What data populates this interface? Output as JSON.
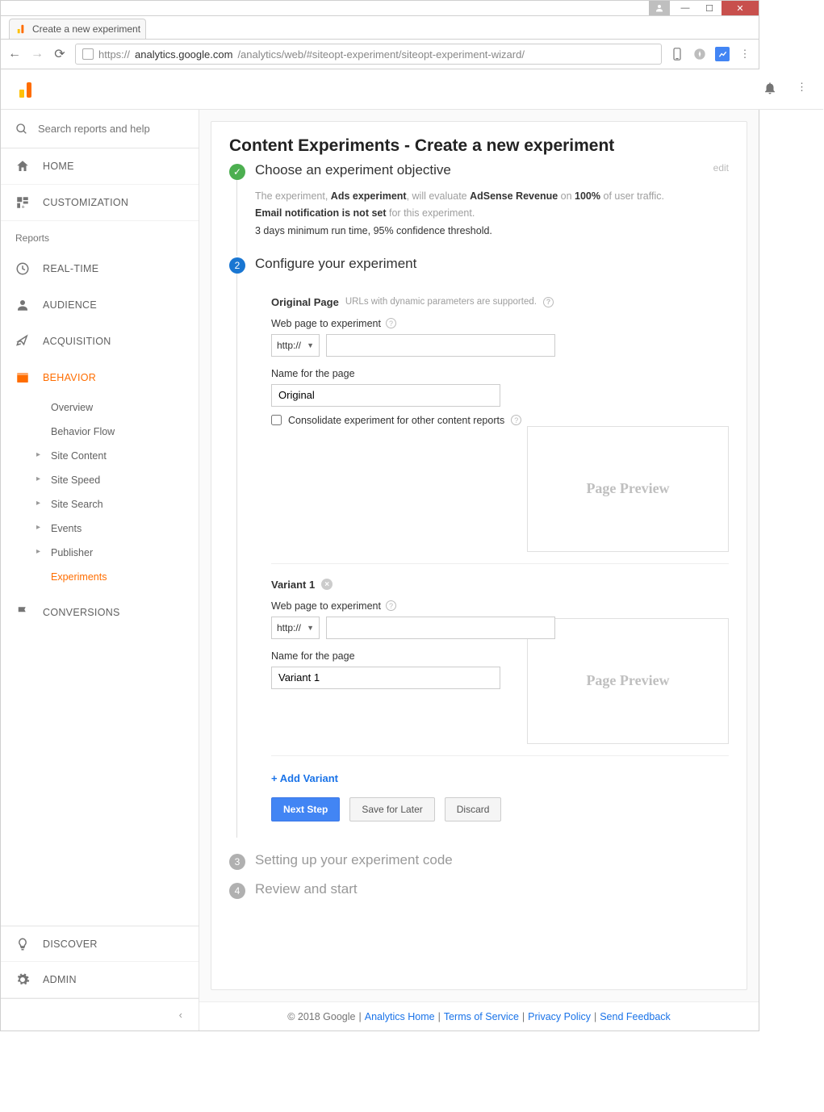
{
  "browser": {
    "tab_title": "Create a new experiment",
    "url_gray_prefix": "https://",
    "url_host": "analytics.google.com",
    "url_path": "/analytics/web/#siteopt-experiment/siteopt-experiment-wizard/"
  },
  "sidebar": {
    "search_placeholder": "Search reports and help",
    "home": "HOME",
    "customization": "CUSTOMIZATION",
    "reports_label": "Reports",
    "realtime": "REAL-TIME",
    "audience": "AUDIENCE",
    "acquisition": "ACQUISITION",
    "behavior": "BEHAVIOR",
    "behavior_sub": {
      "overview": "Overview",
      "flow": "Behavior Flow",
      "site_content": "Site Content",
      "site_speed": "Site Speed",
      "site_search": "Site Search",
      "events": "Events",
      "publisher": "Publisher",
      "experiments": "Experiments"
    },
    "conversions": "CONVERSIONS",
    "discover": "DISCOVER",
    "admin": "ADMIN"
  },
  "page": {
    "title": "Content Experiments - Create a new experiment",
    "step1": {
      "title": "Choose an experiment objective",
      "edit": "edit",
      "l1a": "The experiment, ",
      "l1b": "Ads experiment",
      "l1c": ", will evaluate ",
      "l1d": "AdSense Revenue",
      "l1e": " on ",
      "l1f": "100%",
      "l1g": " of user traffic.",
      "l2a": "Email notification is not set",
      "l2b": " for this experiment.",
      "l3": "3 days minimum run time, 95% confidence threshold."
    },
    "step2": {
      "title": "Configure your experiment",
      "original": {
        "heading": "Original Page",
        "hint": "URLs with dynamic parameters are supported.",
        "web_label": "Web page to experiment",
        "protocol": "http://",
        "url_value": "",
        "name_label": "Name for the page",
        "name_value": "Original",
        "consolidate": "Consolidate experiment for other content reports",
        "preview": "Page Preview"
      },
      "variant": {
        "heading": "Variant 1",
        "web_label": "Web page to experiment",
        "protocol": "http://",
        "url_value": "",
        "name_label": "Name for the page",
        "name_value": "Variant 1",
        "preview": "Page Preview"
      },
      "add_variant": "+ Add Variant",
      "btn_next": "Next Step",
      "btn_save": "Save for Later",
      "btn_discard": "Discard"
    },
    "step3": "Setting up your experiment code",
    "step4": "Review and start"
  },
  "footer": {
    "copy": "© 2018 Google",
    "home": "Analytics Home",
    "terms": "Terms of Service",
    "privacy": "Privacy Policy",
    "feedback": "Send Feedback"
  }
}
